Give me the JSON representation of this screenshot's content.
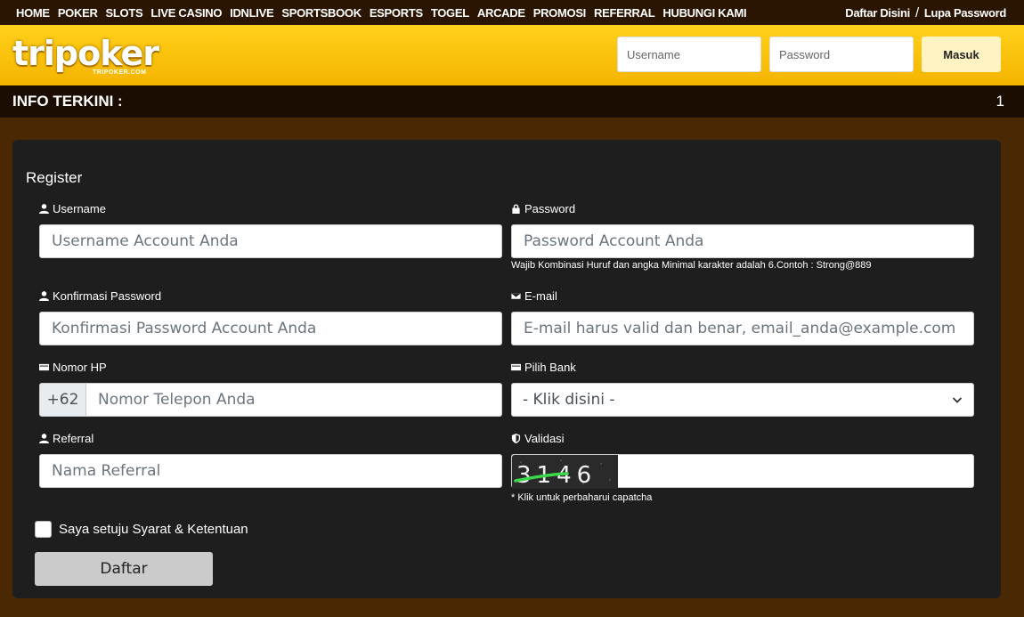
{
  "nav": {
    "items": [
      "HOME",
      "POKER",
      "SLOTS",
      "LIVE CASINO",
      "IDNLIVE",
      "SPORTSBOOK",
      "ESPORTS",
      "TOGEL",
      "ARCADE",
      "PROMOSI",
      "REFERRAL",
      "HUBUNGI KAMI"
    ],
    "register_link": "Daftar Disini",
    "separator": "/",
    "forgot_link": "Lupa Password"
  },
  "header": {
    "logo_word": "tripoker",
    "logo_sub": "TRIPOKER.COM",
    "username_placeholder": "Username",
    "password_placeholder": "Password",
    "login_label": "Masuk"
  },
  "news": {
    "label": "INFO TERKINI :",
    "ticker": "1"
  },
  "register": {
    "title": "Register",
    "username": {
      "label": "Username",
      "placeholder": "Username Account Anda",
      "icon": "user-icon"
    },
    "password": {
      "label": "Password",
      "placeholder": "Password Account Anda",
      "icon": "lock-icon",
      "hint": "Wajib Kombinasi Huruf dan angka Minimal karakter adalah 6.Contoh : Strong@889"
    },
    "confirm": {
      "label": "Konfirmasi Password",
      "placeholder": "Konfirmasi Password Account Anda",
      "icon": "user-icon"
    },
    "email": {
      "label": "E-mail",
      "placeholder": "E-mail harus valid dan benar, email_anda@example.com",
      "icon": "envelope-icon"
    },
    "phone": {
      "label": "Nomor HP",
      "prefix": "+62",
      "placeholder": "Nomor Telepon Anda",
      "icon": "card-icon"
    },
    "bank": {
      "label": "Pilih Bank",
      "selected": "- Klik disini -",
      "icon": "card-icon"
    },
    "referral": {
      "label": "Referral",
      "placeholder": "Nama Referral",
      "icon": "user-icon"
    },
    "captcha": {
      "label": "Validasi",
      "code": "3146",
      "hint": "* Klik untuk perbaharui capatcha",
      "icon": "shield-icon"
    },
    "agree_label": "Saya setuju Syarat & Ketentuan",
    "submit_label": "Daftar"
  },
  "colors": {
    "header_yellow": "#ffd11a",
    "background": "#4a2804",
    "panel": "#1e1e1e",
    "login_button": "#fff3c4"
  }
}
